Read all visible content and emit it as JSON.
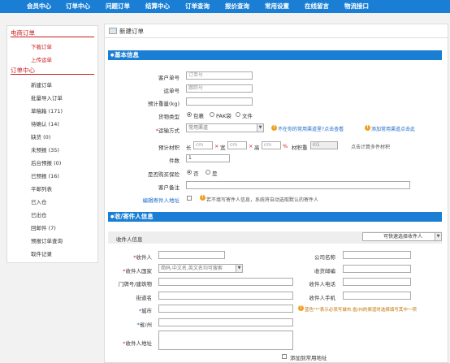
{
  "nav": [
    "会员中心",
    "订单中心",
    "问题订单",
    "结算中心",
    "订单查询",
    "报价查询",
    "常用设置",
    "在线留言",
    "物流接口"
  ],
  "sidebar": {
    "ecom_title": "电商订单",
    "ecom_items": [
      "下载订单",
      "上传运单"
    ],
    "order_title": "订单中心",
    "order_items": [
      "新建订单",
      "批量导入订单",
      "草稿箱 (171)",
      "待确认 (14)",
      "缺货 (0)",
      "未预报 (35)",
      "后台预报 (0)",
      "已预报 (16)",
      "平邮列表",
      "已入仓",
      "已出仓",
      "回邮件 (7)",
      "预报订单查询",
      "取件记录"
    ]
  },
  "page_title": "新建订单",
  "basic": {
    "title": "基本信息",
    "customer_no_label": "客户单号",
    "customer_no_ph": "订单号",
    "tracking_label": "运单号",
    "tracking_ph": "跟踪号",
    "weight_label": "预计重量(kg)",
    "goods_type_label": "货物类型",
    "goods_types": [
      "包裹",
      "PAK袋",
      "文件"
    ],
    "shipping_label": "运输方式",
    "shipping_value": "常用渠道",
    "shipping_hint1": "不在你的常用渠道里?点击查看",
    "shipping_hint2": "添加常用渠道点击此",
    "volume_label": "预计材积",
    "len_label": "长",
    "wid_label": "宽",
    "hei_label": "高",
    "unit_cm": "cm",
    "times": "×",
    "percent": "%",
    "vol_weight_label": "材积重",
    "vol_weight_unit": "KG",
    "multi_calc": "点击计算多件材积",
    "pieces_label": "件数",
    "pieces_value": "1",
    "insure_label": "是否购买保险",
    "insure_no": "否",
    "insure_yes": "是",
    "remark_label": "客户备注",
    "edit_sender_label": "编辑寄件人地址",
    "edit_sender_hint": "若不填写寄件人信息，系统将自动选取默认的寄件人"
  },
  "receiver": {
    "title": "收/寄件人信息",
    "info_label": "收件人信息",
    "select_btn": "可快速选择收件人",
    "name_label": "收件人",
    "country_label": "收件人国家",
    "country_ph": "简码,中文名,英文名均可搜索",
    "house_label": "门牌号/建筑物",
    "street_label": "街道名",
    "city_label": "城市",
    "state_label": "省/州",
    "address_label": "收件人地址",
    "company_label": "公司名称",
    "zip_label": "收货邮编",
    "phone_label": "收件人电话",
    "mobile_label": "收件人手机",
    "city_hint": "蓝色\"*\"表示必须写城市,省/州的渠道时选择填写其中一项",
    "add_common": "添加到常用地址"
  }
}
